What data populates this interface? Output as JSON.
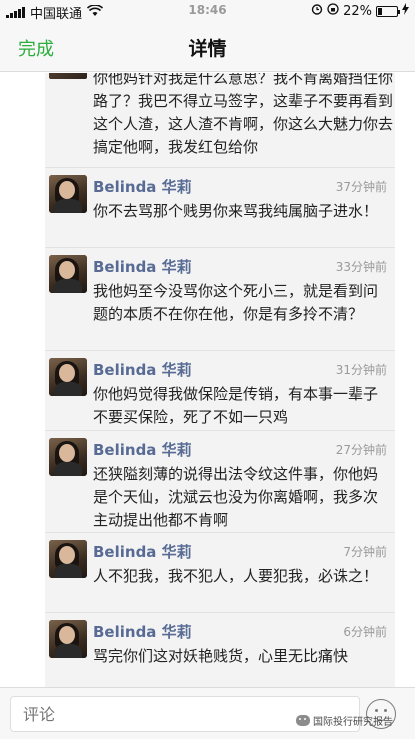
{
  "status_bar": {
    "carrier": "中国联通",
    "time": "18:46",
    "battery": "22%",
    "battery_level": 0.22
  },
  "nav": {
    "done": "完成",
    "title": "详情"
  },
  "top_comment": {
    "text": "你他妈针对我是什么意思？我不肯离婚挡住你路了？我巴不得立马签字，这辈子不要再看到这个人渣，这人渣不肯啊，你这么大魅力你去搞定他啊，我发红包给你"
  },
  "comments": [
    {
      "name": "Belinda 华莉",
      "time": "37分钟前",
      "text": "你不去骂那个贱男你来骂我纯属脑子进水！"
    },
    {
      "name": "Belinda 华莉",
      "time": "33分钟前",
      "text": "我他妈至今没骂你这个死小三，就是看到问题的本质不在你在他，你是有多拎不清？"
    },
    {
      "name": "Belinda 华莉",
      "time": "31分钟前",
      "text": "你他妈觉得我做保险是传销，有本事一辈子不要买保险，死了不如一只鸡"
    },
    {
      "name": "Belinda 华莉",
      "time": "27分钟前",
      "text": "还狭隘刻薄的说得出法令纹这件事，你他妈是个天仙，沈斌云也没为你离婚啊，我多次主动提出他都不肯啊"
    },
    {
      "name": "Belinda 华莉",
      "time": "7分钟前",
      "text": "人不犯我，我不犯人，人要犯我，必诛之！"
    },
    {
      "name": "Belinda 华莉",
      "time": "6分钟前",
      "text": "骂完你们这对妖艳贱货，心里无比痛快"
    }
  ],
  "bottom": {
    "placeholder": "评论",
    "watermark": "国际投行研究报告"
  }
}
